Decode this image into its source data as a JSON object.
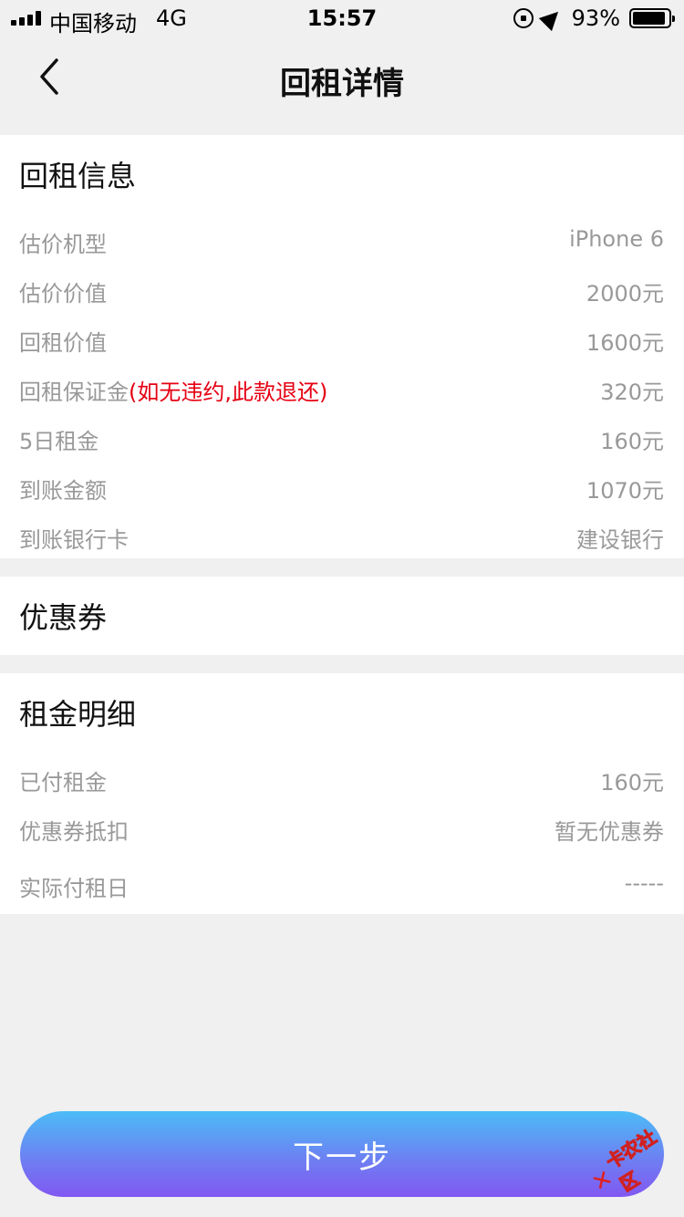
{
  "status_bar": {
    "carrier": "中国移动",
    "network": "4G",
    "time": "15:57",
    "battery": "93%"
  },
  "nav": {
    "title": "回租详情"
  },
  "rent_info": {
    "title": "回租信息",
    "rows": [
      {
        "label": "估价机型",
        "value": "iPhone 6"
      },
      {
        "label": "估价价值",
        "value": "2000元"
      },
      {
        "label": "回租价值",
        "value": "1600元"
      },
      {
        "label": "回租保证金",
        "note": "(如无违约,此款退还)",
        "value": "320元"
      },
      {
        "label": "5日租金",
        "value": "160元"
      },
      {
        "label": "到账金额",
        "value": "1070元"
      },
      {
        "label": "到账银行卡",
        "value": "建设银行"
      }
    ]
  },
  "coupon": {
    "title": "优惠券"
  },
  "rent_detail": {
    "title": "租金明细",
    "rows": [
      {
        "label": "已付租金",
        "value": "160元"
      },
      {
        "label": "优惠券抵扣",
        "value": "暂无优惠券"
      },
      {
        "label": "实际付租日",
        "value": "-----"
      }
    ]
  },
  "next_button": {
    "label": "下一步"
  },
  "watermark": {
    "text": "卡农社区"
  },
  "colors": {
    "accent_red": "#e60012",
    "button_gradient_top": "#4cbcf7",
    "button_gradient_bottom": "#8158f2"
  }
}
